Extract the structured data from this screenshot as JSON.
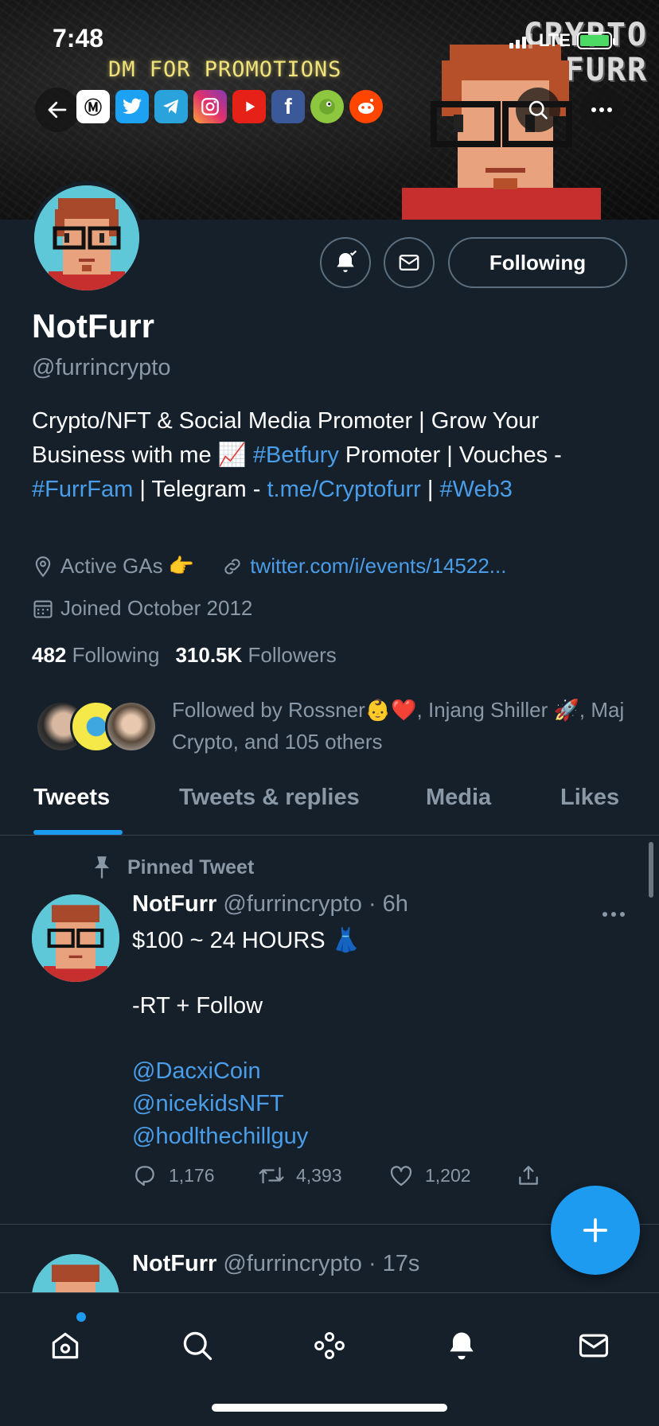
{
  "status_bar": {
    "time": "7:48",
    "network": "LTE"
  },
  "banner": {
    "title_line1": "CRYPTO",
    "title_line2": "FURR",
    "promo_text": "DM FOR PROMOTIONS",
    "social_icons": [
      "coinmarketcap-icon",
      "twitter-icon",
      "telegram-icon",
      "instagram-icon",
      "youtube-icon",
      "facebook-icon",
      "coingecko-icon",
      "reddit-icon"
    ]
  },
  "profile": {
    "display_name": "NotFurr",
    "handle": "@furrincrypto",
    "following_button": "Following",
    "bio": {
      "part1": "Crypto/NFT & Social Media Promoter | Grow Your Business with me 📈 ",
      "tag1": "#Betfury",
      "part2": " Promoter | Vouches - ",
      "tag2": "#FurrFam",
      "part3": " | Telegram - ",
      "link": "t.me/Cryptofurr",
      "part4": " | ",
      "tag3": "#Web3"
    },
    "location": "Active GAs 👉",
    "website": "twitter.com/i/events/14522...",
    "joined": "Joined October 2012",
    "following_count": "482",
    "following_label": "Following",
    "followers_count": "310.5K",
    "followers_label": "Followers",
    "followed_by": "Followed by Rossner👶❤️, Injang Shiller 🚀, Maj Crypto, and 105 others"
  },
  "tabs": [
    {
      "label": "Tweets",
      "active": true
    },
    {
      "label": "Tweets & replies",
      "active": false
    },
    {
      "label": "Media",
      "active": false
    },
    {
      "label": "Likes",
      "active": false
    }
  ],
  "tweets": [
    {
      "pinned_label": "Pinned Tweet",
      "name": "NotFurr",
      "handle": "@furrincrypto",
      "time": "· 6h",
      "line1": "$100 ~ 24 HOURS 👗",
      "line2": "-RT + Follow",
      "mentions": [
        "@DacxiCoin",
        "@nicekidsNFT",
        "@hodlthechillguy"
      ],
      "replies": "1,176",
      "retweets": "4,393",
      "likes": "1,202"
    },
    {
      "name": "NotFurr",
      "handle": "@furrincrypto",
      "time": "· 17s"
    }
  ],
  "colors": {
    "background": "#15202b",
    "accent": "#1d9bf0",
    "link": "#4a9de8",
    "muted": "#8b98a5",
    "border": "#38444d"
  }
}
